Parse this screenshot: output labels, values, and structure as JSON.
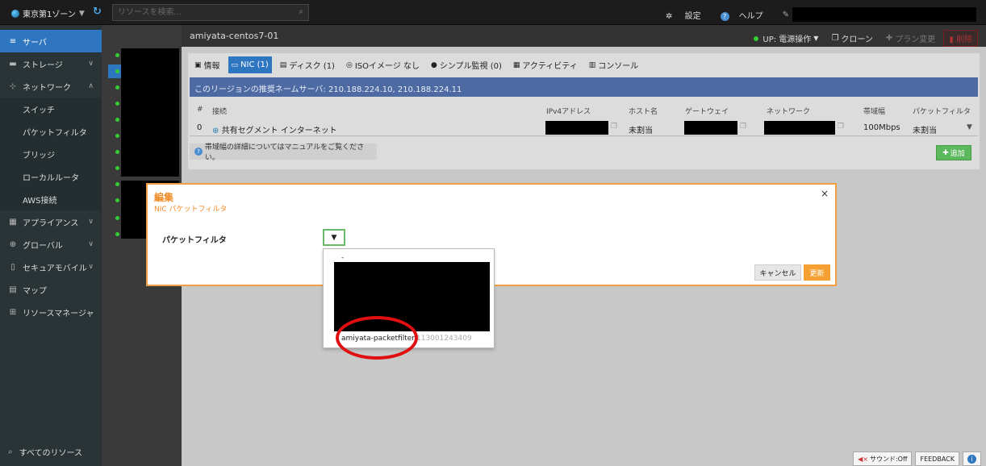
{
  "topbar": {
    "zone": "東京第1ゾーン",
    "search_placeholder": "リソースを検索...",
    "settings": "設定",
    "help": "ヘルプ"
  },
  "sidebar": {
    "items": [
      {
        "label": "サーバ",
        "icon": "server-icon"
      },
      {
        "label": "ストレージ",
        "icon": "storage-icon"
      },
      {
        "label": "ネットワーク",
        "icon": "network-icon"
      }
    ],
    "network_sub": [
      "スイッチ",
      "パケットフィルタ",
      "ブリッジ",
      "ローカルルータ",
      "AWS接続"
    ],
    "items2": [
      {
        "label": "アプライアンス",
        "icon": "appliance-icon"
      },
      {
        "label": "グローバル",
        "icon": "globe-icon"
      },
      {
        "label": "セキュアモバイル",
        "icon": "mobile-icon"
      },
      {
        "label": "マップ",
        "icon": "map-icon"
      },
      {
        "label": "リソースマネージャ",
        "icon": "resource-manager-icon"
      }
    ],
    "all_resources": "すべてのリソース"
  },
  "main": {
    "title": "amiyata-centos7-01",
    "power": "UP: 電源操作",
    "clone": "クローン",
    "plan_change": "プラン変更",
    "delete": "削除"
  },
  "tabs": [
    "情報",
    "NIC (1)",
    "ディスク (1)",
    "ISOイメージ なし",
    "シンプル監視 (0)",
    "アクティビティ",
    "コンソール"
  ],
  "banner": "このリージョンの推奨ネームサーバ: 210.188.224.10, 210.188.224.11",
  "table": {
    "headers": [
      "#",
      "接続",
      "IPv4アドレス",
      "ホスト名",
      "ゲートウェイ",
      "ネットワーク",
      "帯域幅",
      "パケットフィルタ"
    ],
    "row": {
      "num": "0",
      "connection": "共有セグメント インターネット",
      "hostname": "未割当",
      "bandwidth": "100Mbps",
      "packetfilter": "未割当"
    }
  },
  "note": "帯域幅の詳細についてはマニュアルをご覧ください。",
  "add_button": "追加",
  "modal": {
    "title": "編集",
    "subtitle": "NIC パケットフィルタ",
    "field_label": "パケットフィルタ",
    "cancel": "キャンセル",
    "update": "更新"
  },
  "dropdown": {
    "first_option": "-",
    "option_name": "amiyata-packetfilter",
    "option_id": "113001243409"
  },
  "bottom": {
    "sound": "サウンド:Off",
    "feedback": "FEEDBACK"
  },
  "colors": {
    "accent": "#2f76c1",
    "modal_border": "#f0a040",
    "update_button": "#f5a033",
    "add_button": "#5cb85c",
    "highlight_circle": "#e01010"
  }
}
